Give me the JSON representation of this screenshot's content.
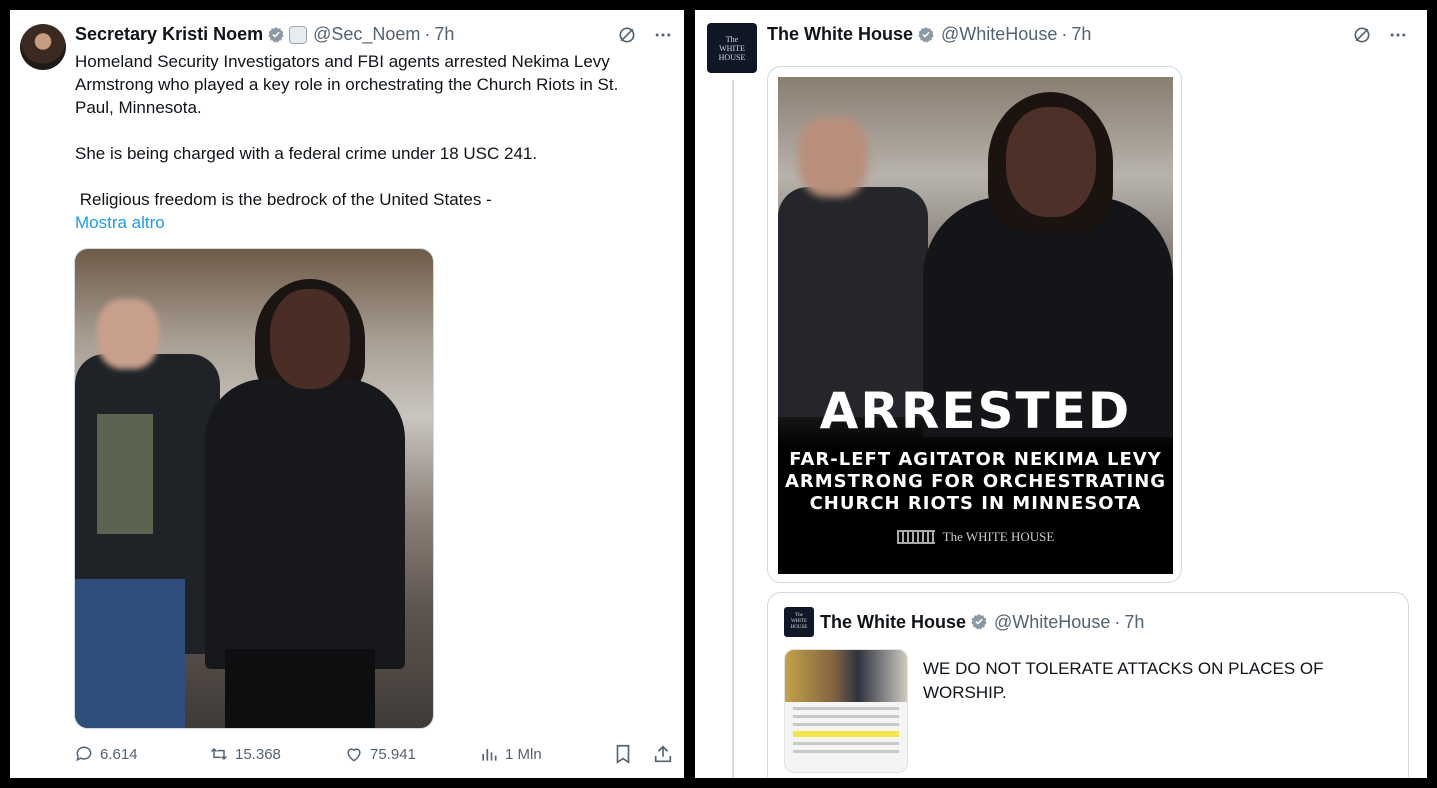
{
  "left_tweet": {
    "author_name": "Secretary Kristi Noem",
    "handle": "@Sec_Noem",
    "time": "7h",
    "paragraphs": [
      "Homeland Security Investigators and FBI agents arrested Nekima Levy Armstrong who played a key role in orchestrating the Church Riots in St. Paul, Minnesota.",
      "She is being charged with a federal crime under 18 USC 241.",
      " Religious freedom is the bedrock of the United States -"
    ],
    "show_more": "Mostra altro",
    "stats": {
      "replies": "6.614",
      "reposts": "15.368",
      "likes": "75.941",
      "views": "1 Mln"
    }
  },
  "right_tweet": {
    "author_name": "The White House",
    "handle": "@WhiteHouse",
    "time": "7h",
    "avatar_text": [
      "The",
      "WHITE",
      "HOUSE"
    ],
    "poster": {
      "title": "ARRESTED",
      "subtitle": [
        "FAR-LEFT AGITATOR NEKIMA LEVY",
        "ARMSTRONG FOR ORCHESTRATING",
        "CHURCH RIOTS IN MINNESOTA"
      ],
      "logo_text": "The WHITE HOUSE"
    },
    "quoted": {
      "author_name": "The White House",
      "handle": "@WhiteHouse",
      "time": "7h",
      "text": "WE DO NOT TOLERATE ATTACKS ON PLACES OF WORSHIP."
    }
  },
  "colors": {
    "verified_blue": "#1d9bf0",
    "link_blue": "#1d9bf0",
    "secondary_text": "#536471",
    "border": "#cfd9de"
  }
}
